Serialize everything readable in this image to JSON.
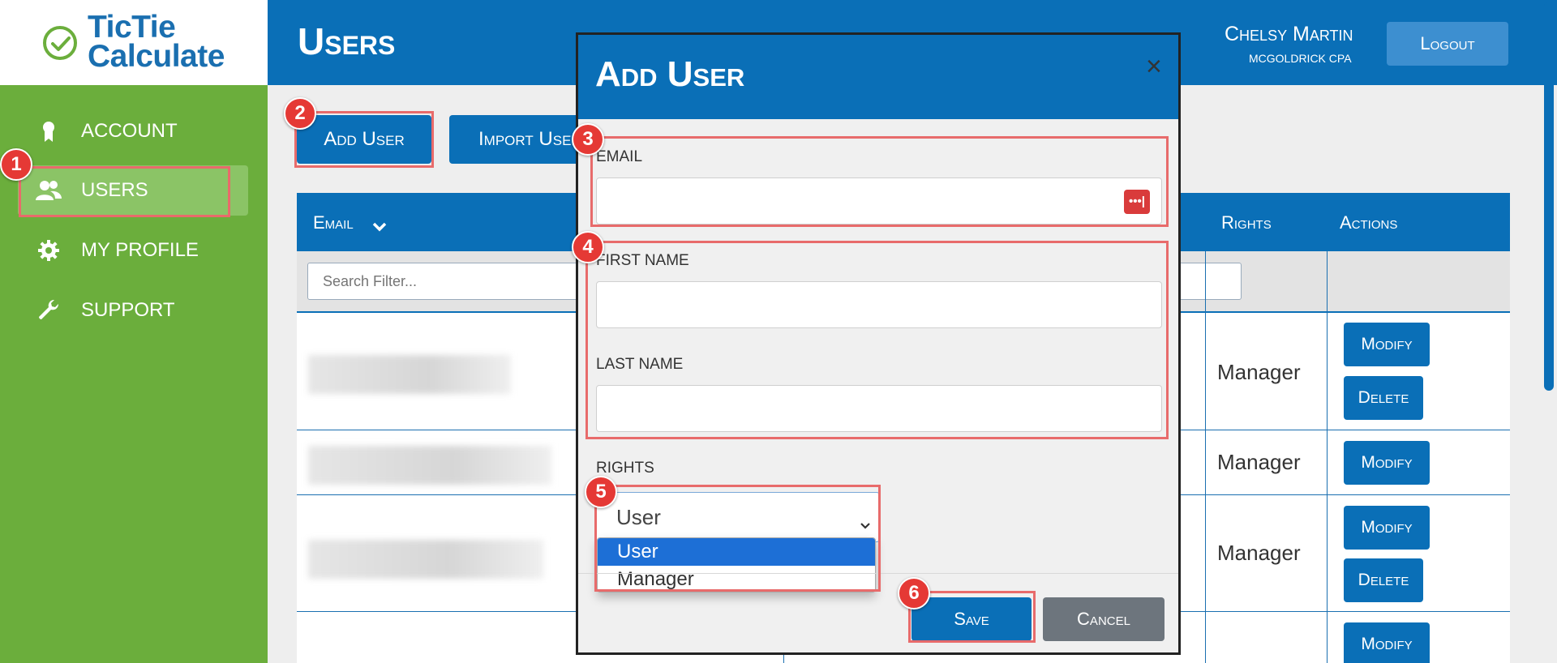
{
  "app": {
    "logo_line1": "TicTie",
    "logo_line2": "Calculate",
    "brand_green": "#6bae3c",
    "brand_blue": "#0a6fb7"
  },
  "sidebar": {
    "items": [
      {
        "label": "ACCOUNT",
        "icon": "ribbon-icon"
      },
      {
        "label": "USERS",
        "icon": "users-icon",
        "active": true
      },
      {
        "label": "MY PROFILE",
        "icon": "gear-icon"
      },
      {
        "label": "SUPPORT",
        "icon": "wrench-icon"
      }
    ]
  },
  "header": {
    "title": "Users",
    "user_name": "Chelsy Martin",
    "user_org": "McGoldrick CPA",
    "logout_label": "Logout"
  },
  "toolbar": {
    "add_user_label": "Add User",
    "import_users_label": "Import Users"
  },
  "table": {
    "columns": [
      "Email",
      "Rights",
      "Actions"
    ],
    "search_placeholder": "Search Filter...",
    "rows": [
      {
        "rights": "Manager",
        "actions": [
          "Modify",
          "Delete"
        ]
      },
      {
        "rights": "Manager",
        "actions": [
          "Modify"
        ]
      },
      {
        "rights": "Manager",
        "actions": [
          "Modify",
          "Delete"
        ]
      },
      {
        "rights": "",
        "actions": [
          "Modify"
        ]
      }
    ]
  },
  "modal": {
    "title": "Add User",
    "close_glyph": "×",
    "email_label": "EMAIL",
    "first_name_label": "FIRST NAME",
    "last_name_label": "LAST NAME",
    "rights_label": "RIGHTS",
    "rights_selected": "User",
    "rights_options": [
      "User",
      "Manager"
    ],
    "save_label": "Save",
    "cancel_label": "Cancel"
  },
  "annotations": [
    "1",
    "2",
    "3",
    "4",
    "5",
    "6"
  ]
}
